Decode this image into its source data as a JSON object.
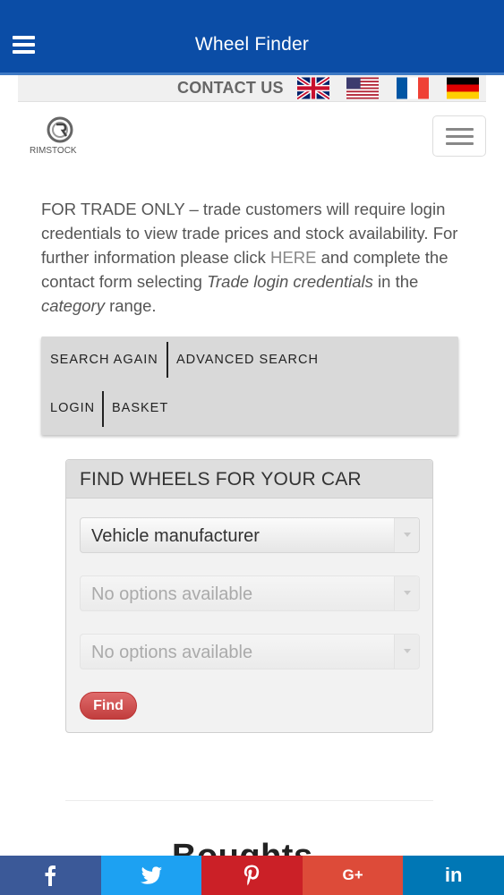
{
  "appbar": {
    "title": "Wheel Finder"
  },
  "contact": {
    "label": "CONTACT US",
    "flags": [
      "uk-flag-icon",
      "us-flag-icon",
      "fr-flag-icon",
      "de-flag-icon"
    ]
  },
  "logo": {
    "text": "RIMSTOCK"
  },
  "notice": {
    "part1": "FOR TRADE ONLY – trade customers will require login credentials to view trade prices and stock availability. For further information please click ",
    "link": "HERE",
    "part2": " and complete the contact form selecting ",
    "em1": "Trade login credentials",
    "part3": " in the ",
    "em2": "category",
    "part4": " range."
  },
  "nav": {
    "search_again": "SEARCH AGAIN",
    "advanced_search": "ADVANCED SEARCH",
    "login": "LOGIN",
    "basket": "BASKET"
  },
  "finder": {
    "title": "FIND WHEELS FOR YOUR CAR",
    "manufacturer": "Vehicle manufacturer",
    "model": "No options available",
    "variant": "No options available",
    "find_label": "Find"
  },
  "partial_heading": "Boughts",
  "share": {
    "colors": {
      "facebook": "#3b5998",
      "twitter": "#1da1f2",
      "pinterest": "#cb2027",
      "google": "#dd4b39",
      "linkedin": "#0077b5"
    },
    "google_label": "G+",
    "linkedin_label": "in"
  },
  "colors": {
    "appbar": "#0b4da6",
    "find_button": "#c94545"
  }
}
